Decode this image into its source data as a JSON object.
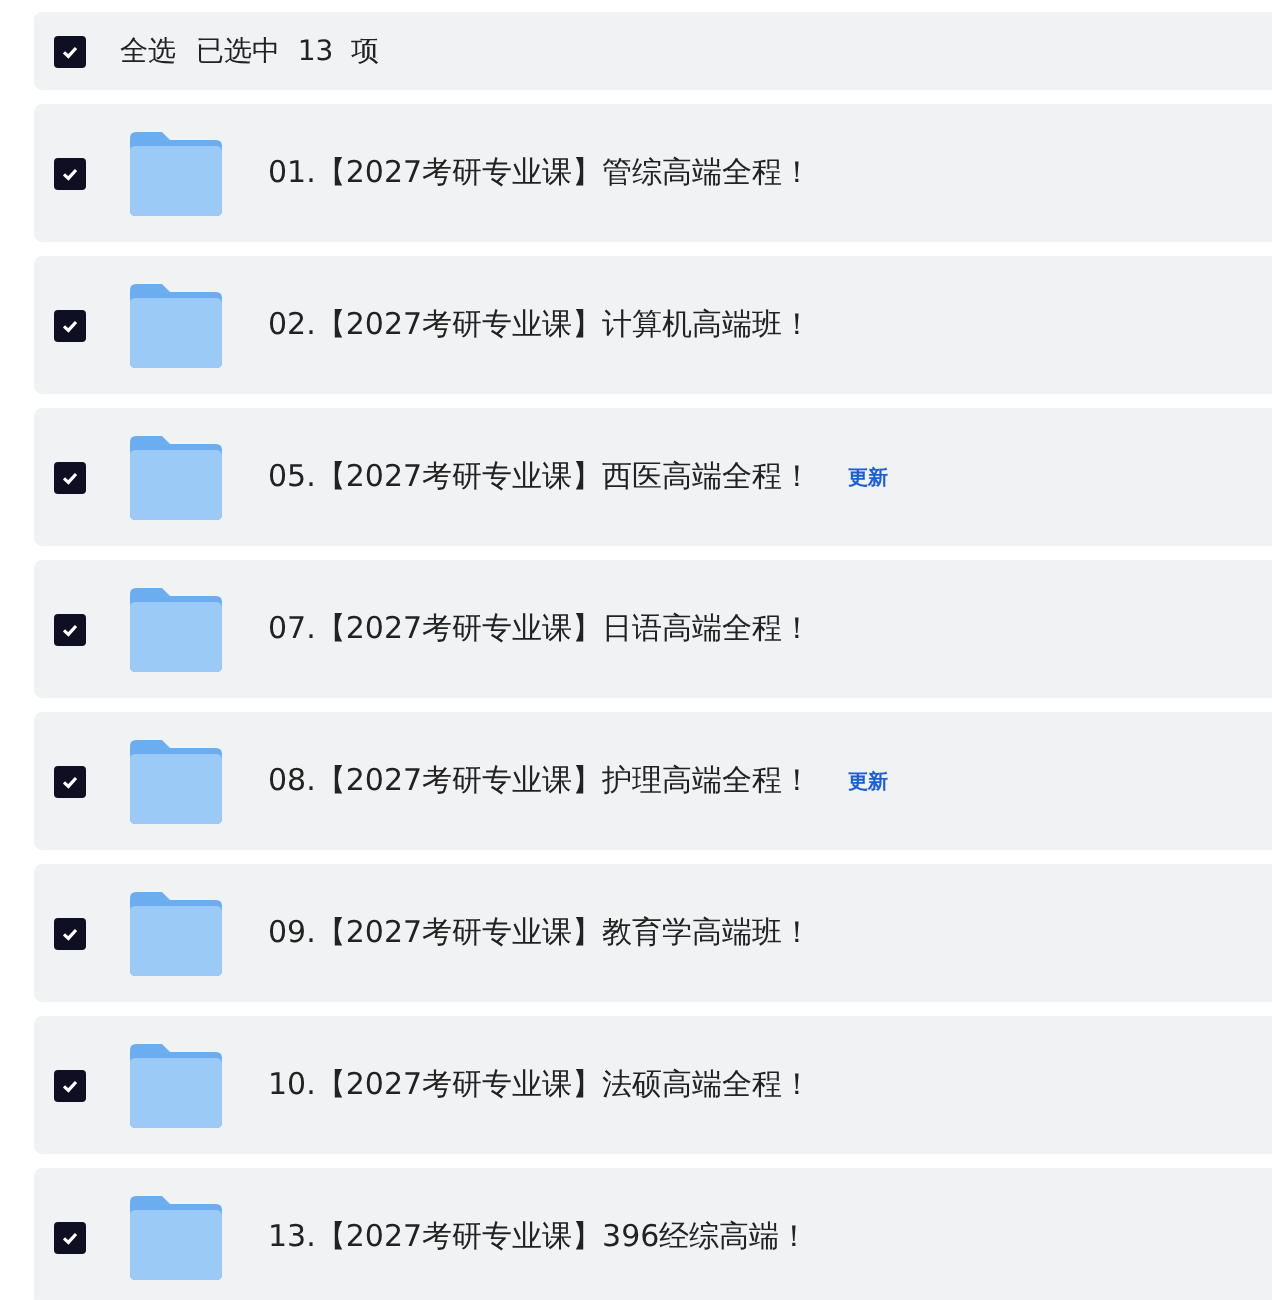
{
  "select_all": {
    "label": "全选",
    "checked": true,
    "summary": "已选中  13  项"
  },
  "items": [
    {
      "name": "01.【2027考研专业课】管综高端全程！",
      "checked": true
    },
    {
      "name": "02.【2027考研专业课】计算机高端班！",
      "checked": true
    },
    {
      "name": "05.【2027考研专业课】西医高端全程！",
      "checked": true,
      "badge": "更新"
    },
    {
      "name": "07.【2027考研专业课】日语高端全程！",
      "checked": true
    },
    {
      "name": "08.【2027考研专业课】护理高端全程！",
      "checked": true,
      "badge": "更新"
    },
    {
      "name": "09.【2027考研专业课】教育学高端班！",
      "checked": true
    },
    {
      "name": "10.【2027考研专业课】法硕高端全程！",
      "checked": true
    },
    {
      "name": "13.【2027考研专业课】396经综高端！",
      "checked": true
    }
  ]
}
